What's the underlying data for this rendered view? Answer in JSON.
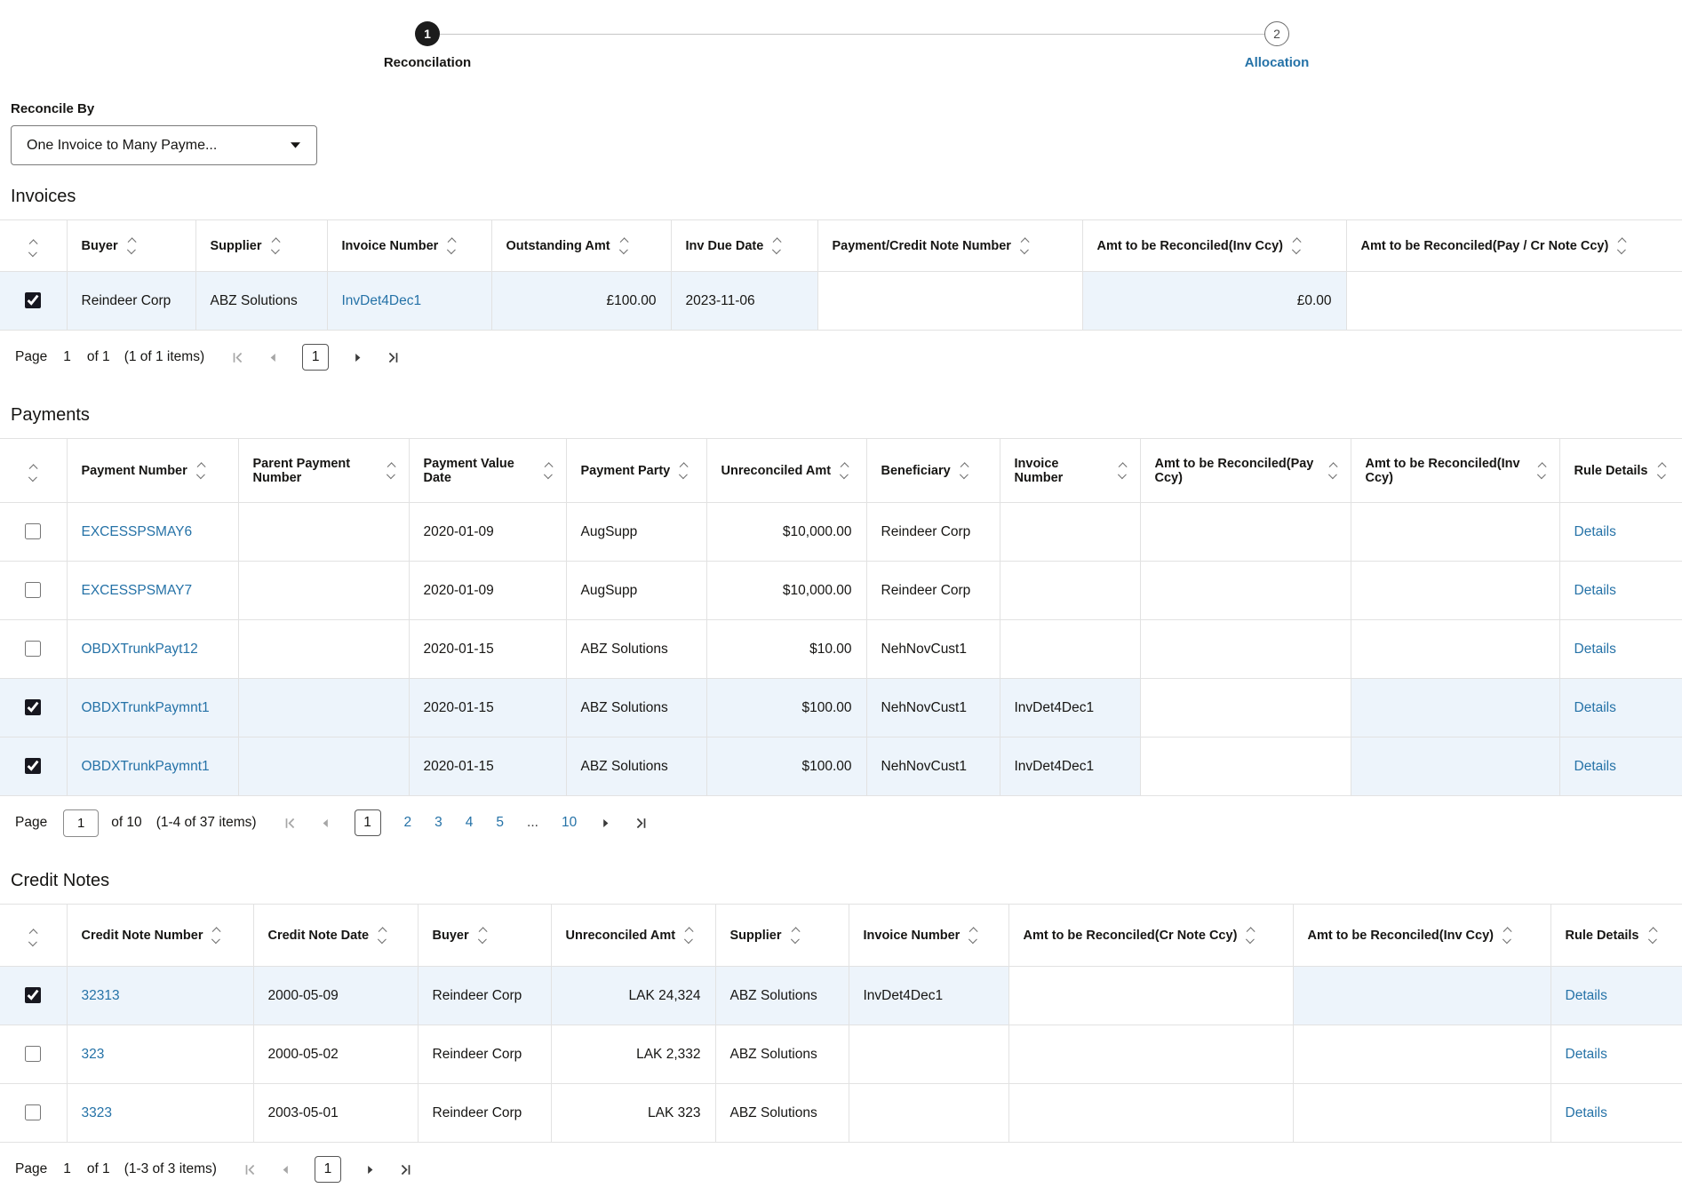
{
  "stepper": {
    "step1": {
      "number": "1",
      "label": "Reconcilation"
    },
    "step2": {
      "number": "2",
      "label": "Allocation"
    }
  },
  "reconcile_by": {
    "label": "Reconcile By",
    "value": "One Invoice to Many Payme..."
  },
  "invoices": {
    "title": "Invoices",
    "columns": {
      "buyer": "Buyer",
      "supplier": "Supplier",
      "invoice_number": "Invoice Number",
      "outstanding_amt": "Outstanding Amt",
      "inv_due_date": "Inv Due Date",
      "pay_cr_note": "Payment/Credit Note Number",
      "amt_inv_ccy": "Amt to be Reconciled(Inv Ccy)",
      "amt_pay_ccy": "Amt to be Reconciled(Pay / Cr Note Ccy)"
    },
    "rows": [
      {
        "checked": "checked",
        "row_class": "selected",
        "buyer": "Reindeer Corp",
        "supplier": "ABZ Solutions",
        "invoice_number": "InvDet4Dec1",
        "outstanding_amt": "£100.00",
        "inv_due_date": "2023-11-06",
        "pay_cr_note": "",
        "amt_inv_ccy": "£0.00",
        "amt_pay_ccy": ""
      }
    ],
    "pagination": {
      "label": "Page",
      "page": "1",
      "of": "of 1",
      "items": "(1 of 1 items)",
      "current": "1"
    }
  },
  "payments": {
    "title": "Payments",
    "details_label": "Details",
    "columns": {
      "payment_number": "Payment Number",
      "parent_payment_number": "Parent Payment Number",
      "payment_value_date": "Payment Value Date",
      "payment_party": "Payment Party",
      "unreconciled_amt": "Unreconciled Amt",
      "beneficiary": "Beneficiary",
      "invoice_number": "Invoice Number",
      "amt_pay_ccy": "Amt to be Reconciled(Pay Ccy)",
      "amt_inv_ccy": "Amt to be Reconciled(Inv Ccy)",
      "rule_details": "Rule Details"
    },
    "rows": [
      {
        "payment_number": "EXCESSPSMAY6",
        "parent_payment_number": "",
        "value_date": "2020-01-09",
        "party": "AugSupp",
        "unreconciled_amt": "$10,000.00",
        "beneficiary": "Reindeer Corp",
        "invoice_number": ""
      },
      {
        "payment_number": "EXCESSPSMAY7",
        "parent_payment_number": "",
        "value_date": "2020-01-09",
        "party": "AugSupp",
        "unreconciled_amt": "$10,000.00",
        "beneficiary": "Reindeer Corp",
        "invoice_number": ""
      },
      {
        "payment_number": "OBDXTrunkPayt12",
        "parent_payment_number": "",
        "value_date": "2020-01-15",
        "party": "ABZ Solutions",
        "unreconciled_amt": "$10.00",
        "beneficiary": "NehNovCust1",
        "invoice_number": ""
      },
      {
        "checked": "checked",
        "row_class": "selected",
        "payment_number": "OBDXTrunkPaymnt1",
        "parent_payment_number": "",
        "value_date": "2020-01-15",
        "party": "ABZ Solutions",
        "unreconciled_amt": "$100.00",
        "beneficiary": "NehNovCust1",
        "invoice_number": "InvDet4Dec1"
      },
      {
        "checked": "checked",
        "row_class": "selected",
        "payment_number": "OBDXTrunkPaymnt1",
        "parent_payment_number": "",
        "value_date": "2020-01-15",
        "party": "ABZ Solutions",
        "unreconciled_amt": "$100.00",
        "beneficiary": "NehNovCust1",
        "invoice_number": "InvDet4Dec1"
      }
    ],
    "pagination": {
      "label": "Page",
      "page": "1",
      "of": "of 10",
      "items": "(1-4 of 37 items)",
      "current": "1",
      "links": [
        "2",
        "3",
        "4",
        "5"
      ],
      "ellipsis": "...",
      "last": "10"
    }
  },
  "credit_notes": {
    "title": "Credit Notes",
    "details_label": "Details",
    "columns": {
      "number": "Credit Note Number",
      "date": "Credit Note Date",
      "buyer": "Buyer",
      "unreconciled_amt": "Unreconciled Amt",
      "supplier": "Supplier",
      "invoice_number": "Invoice Number",
      "amt_cr_note_ccy": "Amt to be Reconciled(Cr Note Ccy)",
      "amt_inv_ccy": "Amt to be Reconciled(Inv Ccy)",
      "rule_details": "Rule Details"
    },
    "rows": [
      {
        "checked": "checked",
        "row_class": "selected",
        "number": "32313",
        "date": "2000-05-09",
        "buyer": "Reindeer Corp",
        "unreconciled_amt": "LAK 24,324",
        "supplier": "ABZ Solutions",
        "invoice_number": "InvDet4Dec1"
      },
      {
        "number": "323",
        "date": "2000-05-02",
        "buyer": "Reindeer Corp",
        "unreconciled_amt": "LAK 2,332",
        "supplier": "ABZ Solutions",
        "invoice_number": ""
      },
      {
        "number": "3323",
        "date": "2003-05-01",
        "buyer": "Reindeer Corp",
        "unreconciled_amt": "LAK 323",
        "supplier": "ABZ Solutions",
        "invoice_number": ""
      }
    ],
    "pagination": {
      "label": "Page",
      "page": "1",
      "of": "of 1",
      "items": "(1-3 of 3 items)",
      "current": "1"
    }
  }
}
